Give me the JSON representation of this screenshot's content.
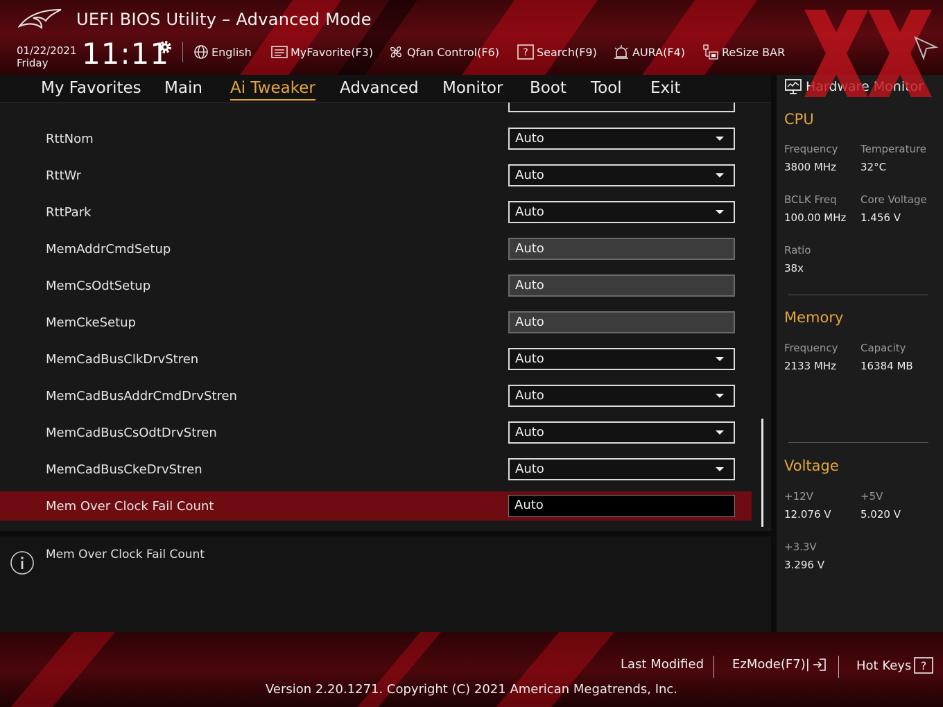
{
  "header": {
    "title": "UEFI BIOS Utility – Advanced Mode",
    "date": "01/22/2021",
    "day": "Friday",
    "time": "11:11",
    "language": "English",
    "my_favorite": "MyFavorite(F3)",
    "qfan": "Qfan Control(F6)",
    "search": "Search(F9)",
    "aura": "AURA(F4)",
    "resize_bar": "ReSize BAR"
  },
  "nav": {
    "tabs": [
      "My Favorites",
      "Main",
      "Ai Tweaker",
      "Advanced",
      "Monitor",
      "Boot",
      "Tool",
      "Exit"
    ],
    "active": "Ai Tweaker"
  },
  "settings": [
    {
      "label": "RttNom",
      "value": "Auto",
      "type": "dropdown"
    },
    {
      "label": "RttWr",
      "value": "Auto",
      "type": "dropdown"
    },
    {
      "label": "RttPark",
      "value": "Auto",
      "type": "dropdown"
    },
    {
      "label": "MemAddrCmdSetup",
      "value": "Auto",
      "type": "text"
    },
    {
      "label": "MemCsOdtSetup",
      "value": "Auto",
      "type": "text"
    },
    {
      "label": "MemCkeSetup",
      "value": "Auto",
      "type": "text"
    },
    {
      "label": "MemCadBusClkDrvStren",
      "value": "Auto",
      "type": "dropdown"
    },
    {
      "label": "MemCadBusAddrCmdDrvStren",
      "value": "Auto",
      "type": "dropdown"
    },
    {
      "label": "MemCadBusCsOdtDrvStren",
      "value": "Auto",
      "type": "dropdown"
    },
    {
      "label": "MemCadBusCkeDrvStren",
      "value": "Auto",
      "type": "dropdown"
    },
    {
      "label": "Mem Over Clock Fail Count",
      "value": "Auto",
      "type": "active-text"
    }
  ],
  "info": {
    "text": "Mem Over Clock Fail Count"
  },
  "hardware_monitor": {
    "title": "Hardware Monitor",
    "cpu": {
      "heading": "CPU",
      "frequency_label": "Frequency",
      "frequency": "3800 MHz",
      "temperature_label": "Temperature",
      "temperature": "32°C",
      "bclk_label": "BCLK Freq",
      "bclk": "100.00 MHz",
      "core_voltage_label": "Core Voltage",
      "core_voltage": "1.456 V",
      "ratio_label": "Ratio",
      "ratio": "38x"
    },
    "memory": {
      "heading": "Memory",
      "frequency_label": "Frequency",
      "frequency": "2133 MHz",
      "capacity_label": "Capacity",
      "capacity": "16384 MB"
    },
    "voltage": {
      "heading": "Voltage",
      "v12_label": "+12V",
      "v12": "12.076 V",
      "v5_label": "+5V",
      "v5": "5.020 V",
      "v33_label": "+3.3V",
      "v33": "3.296 V"
    }
  },
  "footer": {
    "last_modified": "Last Modified",
    "ezmode": "EzMode(F7)|",
    "hot_keys": "Hot Keys",
    "version": "Version 2.20.1271. Copyright (C) 2021 American Megatrends, Inc."
  },
  "colors": {
    "accent": "#e4a63c",
    "selected_row": "#6e0c12",
    "header_red": "#5a0a10"
  }
}
